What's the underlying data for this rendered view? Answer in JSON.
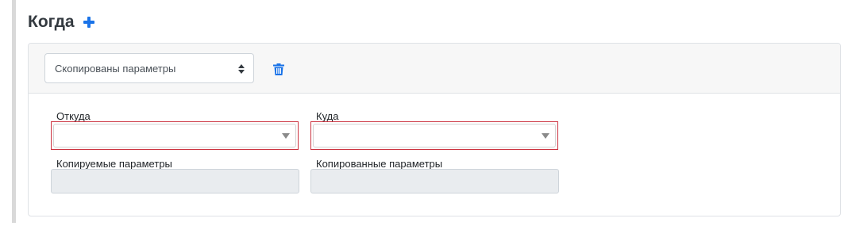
{
  "section": {
    "title": "Когда"
  },
  "condition": {
    "selected_value": "Скопированы параметры"
  },
  "fields": {
    "from_label": "Откуда",
    "to_label": "Куда",
    "from_value": "",
    "to_value": "",
    "copied_params_label": "Копируемые параметры",
    "copied_params_value": "",
    "result_params_label": "Копированные параметры",
    "result_params_value": ""
  },
  "colors": {
    "accent": "#1a73e8",
    "error_border": "#cc3340",
    "readonly_bg": "#e9ecef",
    "header_bg": "#f7f7f7"
  },
  "icons": {
    "add": "plus-icon",
    "delete": "trash-icon",
    "select": "sort-arrows-icon",
    "dropdown": "caret-down-icon"
  }
}
